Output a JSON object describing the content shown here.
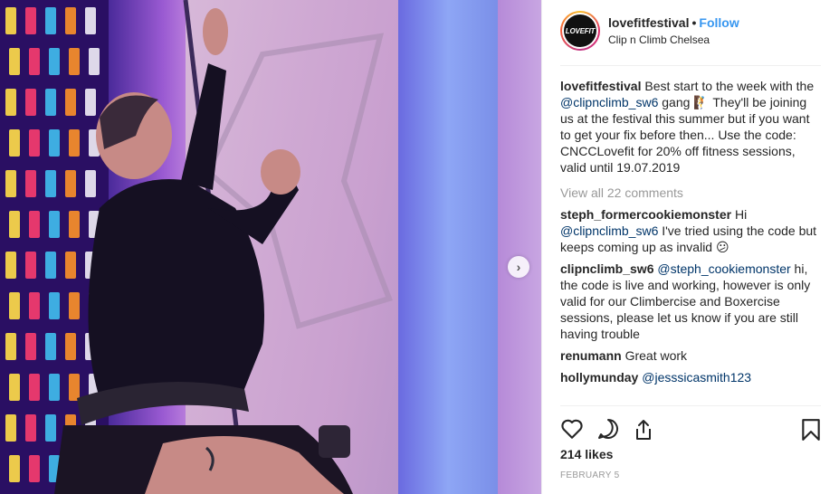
{
  "post": {
    "username": "lovefitfestival",
    "separator": "•",
    "follow_label": "Follow",
    "location": "Clip n Climb Chelsea",
    "avatar_text": "LOVEFIT",
    "caption": {
      "username": "lovefitfestival",
      "part1": " Best start to the week with the ",
      "mention": "@clipnclimb_sw6",
      "part2": " gang 🧗 They'll be joining us at the festival this summer but if you want to get your fix before then... Use the code: CNCCLovefit for 20% off fitness sessions, valid until 19.07.2019"
    },
    "view_all": "View all 22 comments",
    "comments": [
      {
        "username": "steph_formercookiemonster",
        "pre": " Hi ",
        "mention": "@clipnclimb_sw6",
        "text": " I've tried using the code but keeps coming up as invalid 😕"
      },
      {
        "username": "clipnclimb_sw6",
        "pre": " ",
        "mention": "@steph_cookiemonster",
        "text": " hi, the code is live and working, however is only valid for our Climbercise and Boxercise sessions, please let us know if you are still having trouble"
      },
      {
        "username": "renumann",
        "pre": " Great work",
        "mention": "",
        "text": ""
      },
      {
        "username": "hollymunday",
        "pre": " ",
        "mention": "@jesssicasmith123",
        "text": ""
      }
    ],
    "likes": "214 likes",
    "date": "FEBRUARY 5"
  },
  "icons": {
    "heart": "heart-icon",
    "comment": "comment-icon",
    "share": "share-icon",
    "bookmark": "bookmark-icon",
    "next": "chevron-right-icon"
  },
  "colors": {
    "link": "#003569",
    "follow": "#3897f0",
    "muted": "#999999"
  }
}
